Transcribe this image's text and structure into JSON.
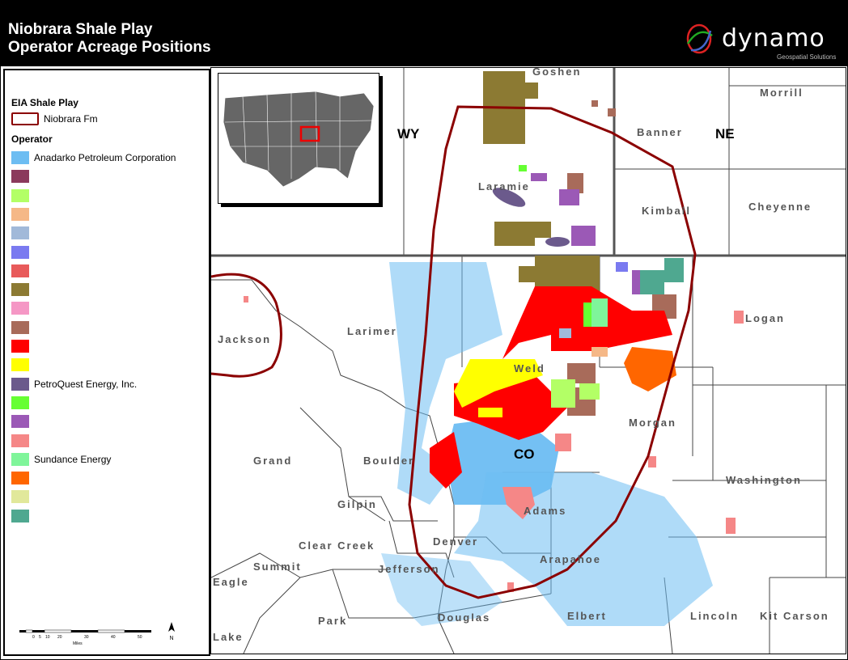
{
  "header": {
    "title_line1": "Niobrara Shale Play",
    "title_line2": "Operator Acreage Positions",
    "logo_text": "dynamo",
    "logo_subtitle": "Geospatial Solutions"
  },
  "legend": {
    "shale_heading": "EIA Shale Play",
    "shale_item": "Niobrara Fm",
    "operator_heading": "Operator",
    "operators": [
      {
        "label": "Anadarko Petroleum Corporation",
        "color": "#6dbdf2"
      },
      {
        "label": "",
        "color": "#8b3a5c"
      },
      {
        "label": "",
        "color": "#b3ff66"
      },
      {
        "label": "",
        "color": "#f5b887"
      },
      {
        "label": "",
        "color": "#a1b9d9"
      },
      {
        "label": "",
        "color": "#7a7af0"
      },
      {
        "label": "",
        "color": "#e85a5a"
      },
      {
        "label": "",
        "color": "#8c7a33"
      },
      {
        "label": "",
        "color": "#f597c5"
      },
      {
        "label": "",
        "color": "#a86b5a"
      },
      {
        "label": "",
        "color": "#ff0000"
      },
      {
        "label": "",
        "color": "#ffff00"
      },
      {
        "label": "PetroQuest Energy, Inc.",
        "color": "#6b5a8c"
      },
      {
        "label": "",
        "color": "#66ff33"
      },
      {
        "label": "",
        "color": "#9b59b6"
      },
      {
        "label": "",
        "color": "#f58787"
      },
      {
        "label": "Sundance Energy",
        "color": "#7ff59a"
      },
      {
        "label": "",
        "color": "#ff6600"
      },
      {
        "label": "",
        "color": "#e1e89b"
      },
      {
        "label": "",
        "color": "#4fa890"
      }
    ],
    "scale_unit": "Miles",
    "scale_ticks": [
      "0",
      "5",
      "10",
      "20",
      "30",
      "40",
      "50"
    ]
  },
  "map": {
    "states": [
      "WY",
      "NE",
      "CO"
    ],
    "counties": {
      "goshen": "Goshen",
      "morrill": "Morrill",
      "banner": "Banner",
      "laramie": "Laramie",
      "kimball": "Kimball",
      "cheyenne": "Cheyenne",
      "jackson": "Jackson",
      "larimer": "Larimer",
      "logan": "Logan",
      "weld": "Weld",
      "morgan": "Morgan",
      "grand": "Grand",
      "boulder": "Boulder",
      "washington": "Washington",
      "gilpin": "Gilpin",
      "adams": "Adams",
      "clear_creek": "Clear Creek",
      "denver": "Denver",
      "summit": "Summit",
      "jefferson": "Jefferson",
      "arapahoe": "Arapahoe",
      "eagle": "Eagle",
      "park": "Park",
      "douglas": "Douglas",
      "elbert": "Elbert",
      "lincoln": "Lincoln",
      "kit_carson": "Kit Carson",
      "lake": "Lake"
    },
    "niobrara_color": "#8b0000"
  }
}
